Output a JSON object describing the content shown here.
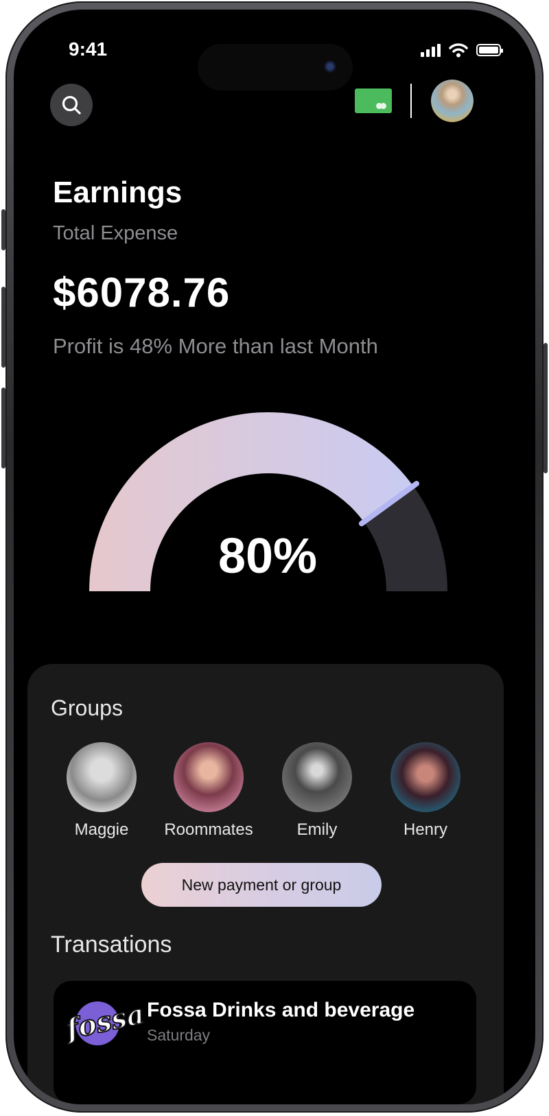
{
  "status_bar": {
    "time": "9:41"
  },
  "header": {
    "search_icon": "search-icon",
    "card_icon": "credit-card-icon"
  },
  "earnings": {
    "title": "Earnings",
    "subtitle": "Total Expense",
    "amount": "$6078.76",
    "profit_text": "Profit is 48% More than last Month",
    "gauge_percent_label": "80%",
    "gauge_value": 0.8
  },
  "groups": {
    "title": "Groups",
    "members": [
      {
        "name": "Maggie"
      },
      {
        "name": "Roommates"
      },
      {
        "name": "Emily"
      },
      {
        "name": "Henry"
      }
    ],
    "cta_label": "New payment or group"
  },
  "transactions": {
    "title": "Transations",
    "items": [
      {
        "merchant": "Fossa Drinks and beverage",
        "date": "Saturday",
        "logo_text": "fossa"
      }
    ]
  },
  "colors": {
    "background": "#000000",
    "panel": "#1a1a1a",
    "card_icon": "#4cbb5e",
    "gauge_start": "#e6c8cc",
    "gauge_end": "#c9cbf2",
    "gauge_track": "#2d2d33",
    "needle": "#b3b6f2"
  }
}
